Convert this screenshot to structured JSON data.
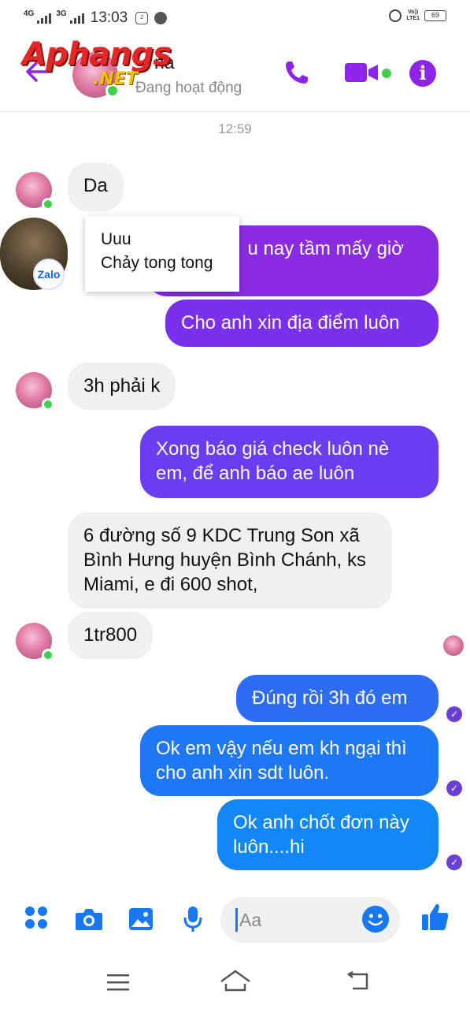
{
  "status_bar": {
    "net_left": "4G",
    "net_right": "3G",
    "time": "13:03",
    "carrier": "Vo))\nLTE1",
    "battery": "69"
  },
  "header": {
    "logo_main": "Aphangs",
    "logo_sub": ".NET",
    "contact_name_partial": "na",
    "contact_status": "Đang hoạt động",
    "accent_color": "#8e24ea"
  },
  "timestamp": "12:59",
  "popup": {
    "title": "Uuu",
    "message": "Chảy tong tong",
    "badge": "Zalo"
  },
  "messages": [
    {
      "side": "in",
      "text": "Da"
    },
    {
      "side": "out",
      "text": "u nay tầm mấy giờ",
      "color": "#8a2be2"
    },
    {
      "side": "out",
      "text": "Cho anh xin địa điểm luôn",
      "color": "#7a30ea"
    },
    {
      "side": "in",
      "text": "3h phải k"
    },
    {
      "side": "out",
      "text": "Xong báo giá check luôn nè em, để anh báo ae luôn",
      "color": "#6a3ef0"
    },
    {
      "side": "in",
      "text": "6 đường số 9 KDC Trung Son xã Bình Hưng huyện Bình Chánh, ks Miami, e đi 600 shot,"
    },
    {
      "side": "in",
      "text": "1tr800"
    },
    {
      "side": "out",
      "text": "Đúng rồi 3h đó em",
      "color": "#2d6cf4"
    },
    {
      "side": "out",
      "text": "Ok em vậy nếu em kh ngại thì cho anh xin sdt luôn.",
      "color": "#1e78f6"
    },
    {
      "side": "out",
      "text": "Ok anh chốt đơn này luôn....hi",
      "color": "#1287f8"
    }
  ],
  "composer": {
    "placeholder": "Aa",
    "icon_color": "#1877f2"
  }
}
